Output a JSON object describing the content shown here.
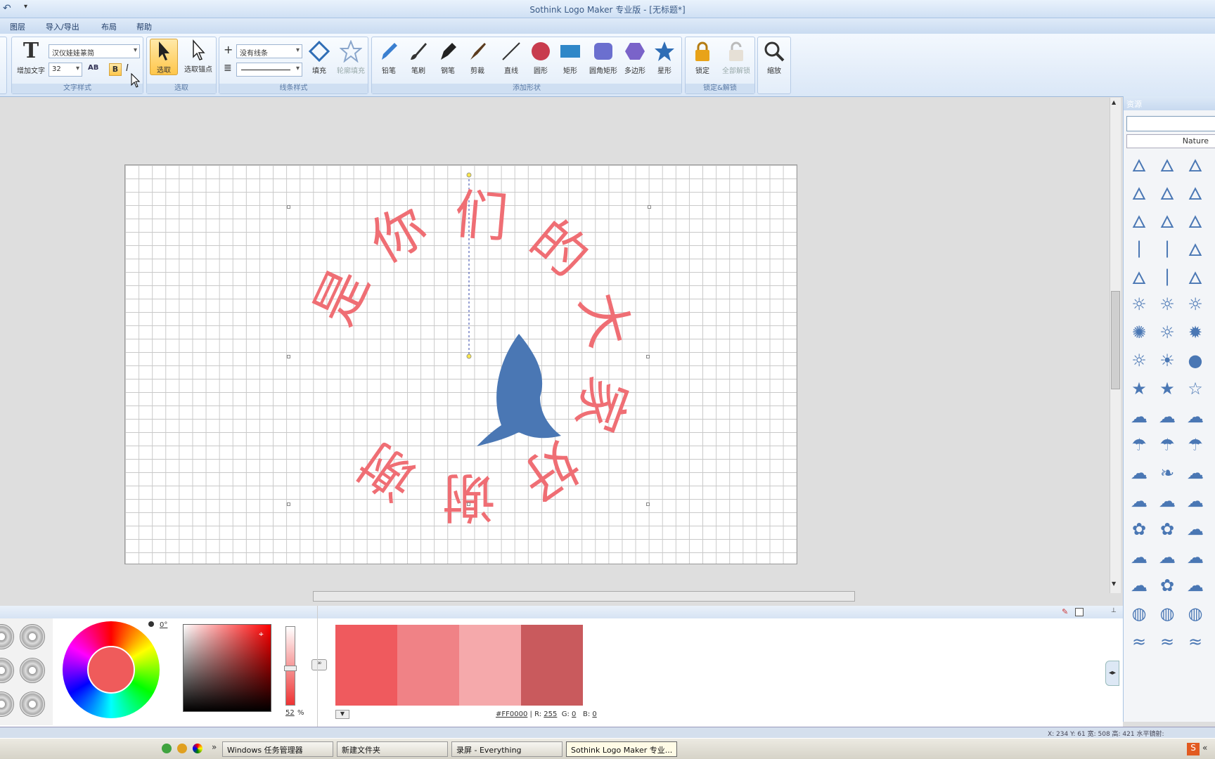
{
  "window": {
    "title": "Sothink Logo Maker 专业版 - [无标题*]"
  },
  "menu": [
    "图层",
    "导入/导出",
    "布局",
    "帮助"
  ],
  "ribbon": {
    "text_group": {
      "caption": "文字样式",
      "add_text": "增加文字",
      "font": "汉仪娃娃篆简",
      "size": "32",
      "bold": "B",
      "italic": "I",
      "spacing": "AB"
    },
    "select_group": {
      "caption": "选取",
      "select": "选取",
      "select_anchor": "选取锚点"
    },
    "line_group": {
      "caption": "线条样式",
      "line": "没有线条",
      "fill": "填充",
      "outline_fill": "轮廓填充"
    },
    "shape_group": {
      "caption": "添加形状",
      "pencil": "铅笔",
      "brush": "笔刷",
      "pen": "钢笔",
      "scissors": "剪裁",
      "line": "直线",
      "circle": "圆形",
      "rect": "矩形",
      "round_rect": "圆角矩形",
      "polygon": "多边形",
      "star": "星形"
    },
    "lock_group": {
      "caption": "锁定&解锁",
      "lock": "锁定",
      "unlock_all": "全部解锁"
    },
    "zoom_group": {
      "zoom": "缩放"
    }
  },
  "canvas": {
    "logo_text": "是你们的大家好谢谢",
    "colors": {
      "text": "#ef6e74",
      "flame": "#4a77b4"
    }
  },
  "resources": {
    "title": "资源",
    "category": "Nature",
    "search_value": ""
  },
  "colorpanel": {
    "hue_angle": "0°",
    "alpha": "52",
    "alpha_unit": "%",
    "hex": "#FF0000",
    "r_label": "R:",
    "r": "255",
    "g_label": "G:",
    "g": "0",
    "b_label": "B:",
    "b": "0",
    "swatches": [
      "#ef5a5e",
      "#f08286",
      "#f5a9ab",
      "#c95a5d"
    ]
  },
  "status": "X: 234   Y: 61   宽: 508   高: 421   水平镜射:",
  "taskbar": [
    "Windows 任务管理器",
    "新建文件夹",
    "录屏 - Everything",
    "Sothink Logo Maker 专业..."
  ]
}
